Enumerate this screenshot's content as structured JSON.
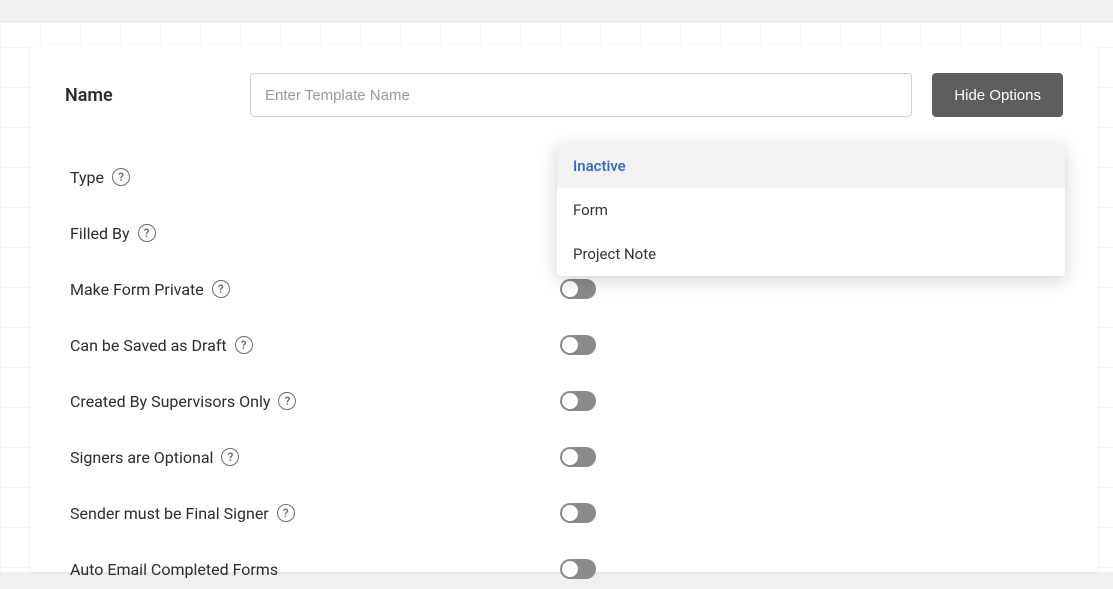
{
  "header": {
    "name_label": "Name",
    "name_placeholder": "Enter Template Name",
    "name_value": "",
    "hide_options_label": "Hide Options"
  },
  "dropdown": {
    "items": [
      {
        "label": "Inactive",
        "selected": true
      },
      {
        "label": "Form",
        "selected": false
      },
      {
        "label": "Project Note",
        "selected": false
      }
    ]
  },
  "options": [
    {
      "label": "Type",
      "help": true,
      "control": "dropdown"
    },
    {
      "label": "Filled By",
      "help": true,
      "control": "dropdown"
    },
    {
      "label": "Make Form Private",
      "help": true,
      "control": "toggle",
      "value": false
    },
    {
      "label": "Can be Saved as Draft",
      "help": true,
      "control": "toggle",
      "value": false
    },
    {
      "label": "Created By Supervisors Only",
      "help": true,
      "control": "toggle",
      "value": false
    },
    {
      "label": "Signers are Optional",
      "help": true,
      "control": "toggle",
      "value": false
    },
    {
      "label": "Sender must be Final Signer",
      "help": true,
      "control": "toggle",
      "value": false
    },
    {
      "label": "Auto Email Completed Forms",
      "help": false,
      "control": "toggle",
      "value": false
    }
  ]
}
